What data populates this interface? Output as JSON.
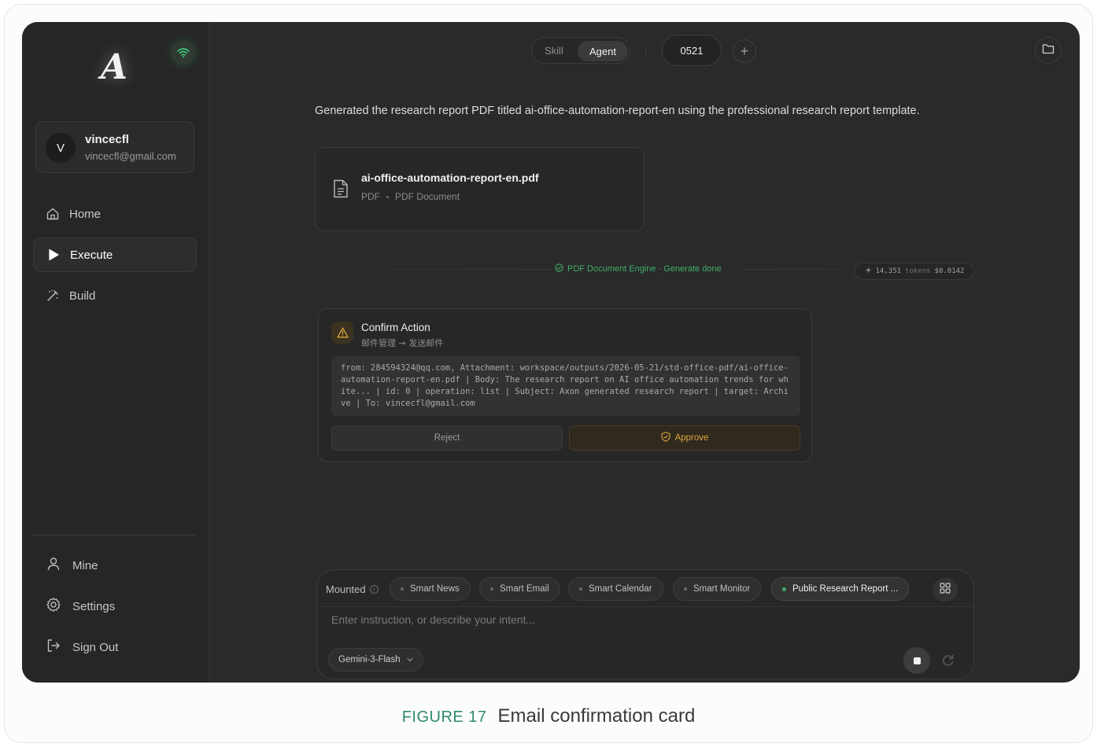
{
  "sidebar": {
    "logo_letter": "A",
    "user": {
      "initial": "V",
      "name": "vincecfl",
      "email": "vincecfl@gmail.com"
    },
    "nav": [
      {
        "label": "Home",
        "icon": "home-icon",
        "active": false
      },
      {
        "label": "Execute",
        "icon": "play-icon",
        "active": true
      },
      {
        "label": "Build",
        "icon": "magic-wand-icon",
        "active": false
      }
    ],
    "bottom": [
      {
        "label": "Mine",
        "icon": "user-icon"
      },
      {
        "label": "Settings",
        "icon": "gear-icon"
      },
      {
        "label": "Sign Out",
        "icon": "sign-out-icon"
      }
    ]
  },
  "topbar": {
    "modes": [
      "Skill",
      "Agent"
    ],
    "active_mode": "Agent",
    "session": "0521",
    "add_symbol": "+"
  },
  "main": {
    "message": "Generated the research report PDF titled ai-office-automation-report-en using the professional research report template.",
    "file": {
      "name": "ai-office-automation-report-en.pdf",
      "type": "PDF",
      "kind": "PDF Document"
    },
    "engine_status": "PDF Document Engine · Generate done",
    "tokens": {
      "count": "14,351",
      "unit": "tokens",
      "cost": "$0.0142"
    },
    "confirm": {
      "title": "Confirm Action",
      "subtitle": "邮件管理 → 发送邮件",
      "body": "from: 284594324@qq.com, Attachment: workspace/outputs/2026-05-21/std-office-pdf/ai-office-automation-report-en.pdf | Body: The research report on AI office automation trends for white... | id: 0 | operation: list | Subject: Axon generated research report | target: Archive | To: vincecfl@gmail.com",
      "reject_label": "Reject",
      "approve_label": "Approve"
    }
  },
  "composer": {
    "mounted_label": "Mounted",
    "chips": [
      "Smart News",
      "Smart Email",
      "Smart Calendar",
      "Smart Monitor",
      "Public Research Report ..."
    ],
    "active_chip": "Public Research Report ...",
    "placeholder": "Enter instruction, or describe your intent...",
    "model": "Gemini-3-Flash"
  },
  "caption": {
    "figure": "FIGURE 17",
    "text": "Email confirmation card"
  },
  "colors": {
    "accent_green": "#3fae6a",
    "warning_amber": "#d9a53a",
    "app_bg": "#2a2a2a"
  }
}
